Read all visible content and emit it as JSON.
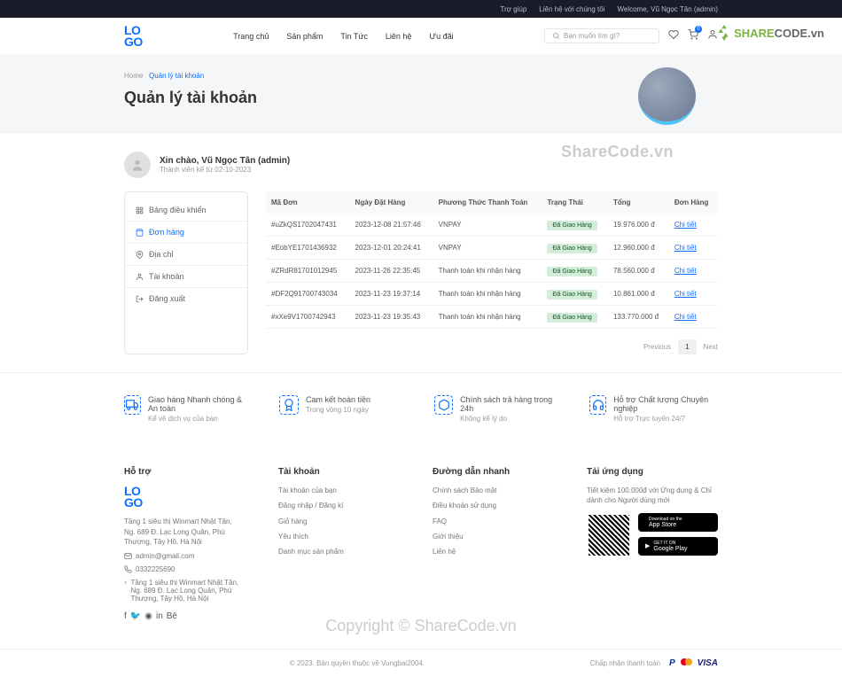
{
  "topbar": {
    "help": "Trợ giúp",
    "contact": "Liên hệ với chúng tôi",
    "welcome": "Welcome, Vũ Ngọc Tân (admin)"
  },
  "header": {
    "logo": "LO\nGO",
    "nav": [
      "Trang chủ",
      "Sản phẩm",
      "Tin Tức",
      "Liên hệ",
      "Ưu đãi"
    ],
    "search_placeholder": "Bạn muốn tìm gì?",
    "cart_badge": "0",
    "sharecode": {
      "share": "SHARE",
      "code": "CODE",
      "vn": ".vn"
    }
  },
  "hero": {
    "breadcrumb_home": "Home",
    "breadcrumb_current": "Quản lý tài khoản",
    "title": "Quản lý tài khoản",
    "watermark": "ShareCode.vn"
  },
  "user": {
    "greeting": "Xin chào, Vũ Ngọc Tân (admin)",
    "member_since": "Thành viên kể từ 02-10-2023"
  },
  "sidebar": {
    "items": [
      "Bảng điều khiển",
      "Đơn hàng",
      "Địa chỉ",
      "Tài khoản",
      "Đăng xuất"
    ]
  },
  "orders": {
    "headers": [
      "Mã Đơn",
      "Ngày Đặt Hàng",
      "Phương Thức Thanh Toán",
      "Trạng Thái",
      "Tổng",
      "Đơn Hàng"
    ],
    "rows": [
      {
        "id": "#uZkQS1702047431",
        "date": "2023-12-08 21:57:46",
        "method": "VNPAY",
        "status": "Đã Giao Hàng",
        "total": "19.976.000 đ",
        "action": "Chi tiết"
      },
      {
        "id": "#EobYE1701436932",
        "date": "2023-12-01 20:24:41",
        "method": "VNPAY",
        "status": "Đã Giao Hàng",
        "total": "12.960.000 đ",
        "action": "Chi tiết"
      },
      {
        "id": "#ZRdR81701012945",
        "date": "2023-11-26 22:35:45",
        "method": "Thanh toán khi nhận hàng",
        "status": "Đã Giao Hàng",
        "total": "78.560.000 đ",
        "action": "Chi tiết"
      },
      {
        "id": "#DF2Q91700743034",
        "date": "2023-11-23 19:37:14",
        "method": "Thanh toán khi nhận hàng",
        "status": "Đã Giao Hàng",
        "total": "10.861.000 đ",
        "action": "Chi tiết"
      },
      {
        "id": "#xXe9V1700742943",
        "date": "2023-11-23 19:35:43",
        "method": "Thanh toán khi nhận hàng",
        "status": "Đã Giao Hàng",
        "total": "133.770.000 đ",
        "action": "Chi tiết"
      }
    ],
    "pagination": {
      "prev": "Previous",
      "page": "1",
      "next": "Next"
    }
  },
  "features": [
    {
      "title": "Giao hàng Nhanh chóng & An toàn",
      "sub": "Kể về dịch vụ của bạn"
    },
    {
      "title": "Cam kết hoàn tiền",
      "sub": "Trong vòng 10 ngày"
    },
    {
      "title": "Chính sách trả hàng trong 24h",
      "sub": "Không kể lý do"
    },
    {
      "title": "Hỗ trợ Chất lượng Chuyên nghiệp",
      "sub": "Hỗ trợ Trực tuyến 24/7"
    }
  ],
  "footer": {
    "support": {
      "title": "Hỗ trợ",
      "address": "Tầng 1 siêu thị Winmart Nhật Tân, Ng. 689 Đ. Lạc Long Quân, Phú Thượng, Tây Hồ, Hà Nội",
      "email": "admin@gmail.com",
      "phone": "0332225690",
      "address2": "Tầng 1 siêu thị Winmart Nhật Tân, Ng. 689 Đ. Lạc Long Quân, Phú Thượng, Tây Hồ, Hà Nội"
    },
    "account": {
      "title": "Tài khoản",
      "links": [
        "Tài khoản của bạn",
        "Đăng nhập / Đăng kí",
        "Giỏ hàng",
        "Yêu thích",
        "Danh mục sản phẩm"
      ]
    },
    "quick": {
      "title": "Đường dẫn nhanh",
      "links": [
        "Chính sách Bảo mật",
        "Điều khoản sử dụng",
        "FAQ",
        "Giới thiệu",
        "Liên hệ"
      ]
    },
    "app": {
      "title": "Tải ứng dụng",
      "desc": "Tiết kiệm 100.000đ với Ứng dụng & Chỉ dành cho Người dùng mới",
      "appstore_small": "Download on the",
      "appstore": "App Store",
      "play_small": "GET IT ON",
      "play": "Google Play"
    }
  },
  "copyright_watermark": "Copyright © ShareCode.vn",
  "bottom": {
    "copyright": "© 2023. Bản quyền thuộc về Vungbai2004.",
    "accept": "Chấp nhận thanh toán"
  }
}
